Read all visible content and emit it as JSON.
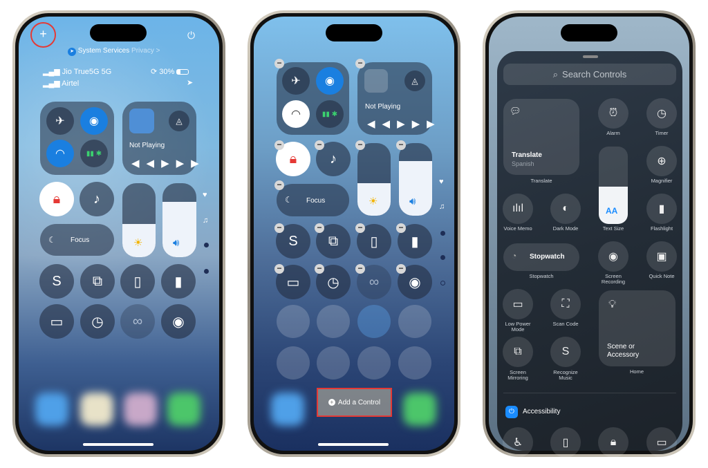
{
  "phone1": {
    "privacy_title": "System Services",
    "privacy_link": "Privacy >",
    "carrier1": "Jio True5G 5G",
    "carrier2": "Airtel",
    "battery": "30%",
    "now_playing": "Not Playing",
    "focus": "Focus",
    "annotation_color": "#e53935"
  },
  "phone2": {
    "now_playing": "Not Playing",
    "focus": "Focus",
    "add_control": "Add a Control",
    "annotation_color": "#e53935"
  },
  "phone3": {
    "search_placeholder": "Search Controls",
    "translate_title": "Translate",
    "translate_sub": "Spanish",
    "translate_label": "Translate",
    "alarm": "Alarm",
    "timer": "Timer",
    "magnifier": "Magnifier",
    "voice_memo": "Voice Memo",
    "dark_mode": "Dark Mode",
    "text_size": "Text Size",
    "text_size_glyph": "AA",
    "text_size_level": 0.4,
    "flashlight": "Flashlight",
    "stopwatch_title": "Stopwatch",
    "stopwatch_label": "Stopwatch",
    "screen_recording": "Screen Recording",
    "quick_note": "Quick Note",
    "low_power": "Low Power Mode",
    "scan_code": "Scan Code",
    "home_title": "Scene or Accessory",
    "home_label": "Home",
    "screen_mirroring": "Screen Mirroring",
    "recognize_music": "Recognize Music",
    "section_accessibility": "Accessibility",
    "accent": "#1a8cff"
  }
}
